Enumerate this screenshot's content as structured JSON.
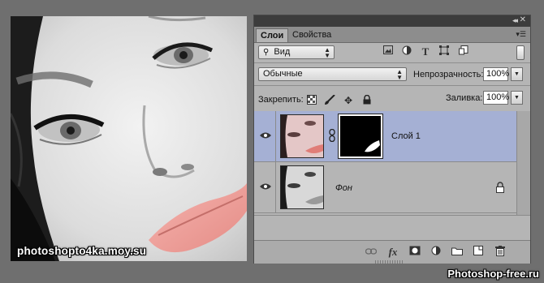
{
  "photo": {
    "watermark": "photoshopto4ka.moy.su"
  },
  "panel": {
    "tabs": [
      {
        "label": "Слои",
        "active": true
      },
      {
        "label": "Свойства",
        "active": false
      }
    ],
    "filter": {
      "kind_label": "Вид",
      "icons": [
        "image-filter-icon",
        "adjustment-filter-icon",
        "type-filter-icon",
        "shape-filter-icon",
        "smart-object-filter-icon"
      ]
    },
    "blend": {
      "mode": "Обычные"
    },
    "opacity": {
      "label": "Непрозрачность:",
      "value": "100%"
    },
    "lock": {
      "label": "Закрепить:"
    },
    "fill": {
      "label": "Заливка:",
      "value": "100%"
    },
    "layers": [
      {
        "name": "Слой 1",
        "selected": true,
        "visible": true,
        "has_mask": true
      },
      {
        "name": "Фон",
        "selected": false,
        "visible": true,
        "locked": true
      }
    ],
    "footer_icons": [
      "link-layers-icon",
      "fx-icon",
      "add-mask-icon",
      "adjustment-layer-icon",
      "new-group-icon",
      "new-layer-icon",
      "delete-layer-icon"
    ],
    "fx_label": "fx"
  },
  "site_mark": "Photoshop-free.ru",
  "colors": {
    "selection": "#a5b0d4",
    "panel_bg": "#b5b5b5",
    "tab_strip": "#8d8d8d",
    "lip_tint": "#f2a4a0"
  }
}
